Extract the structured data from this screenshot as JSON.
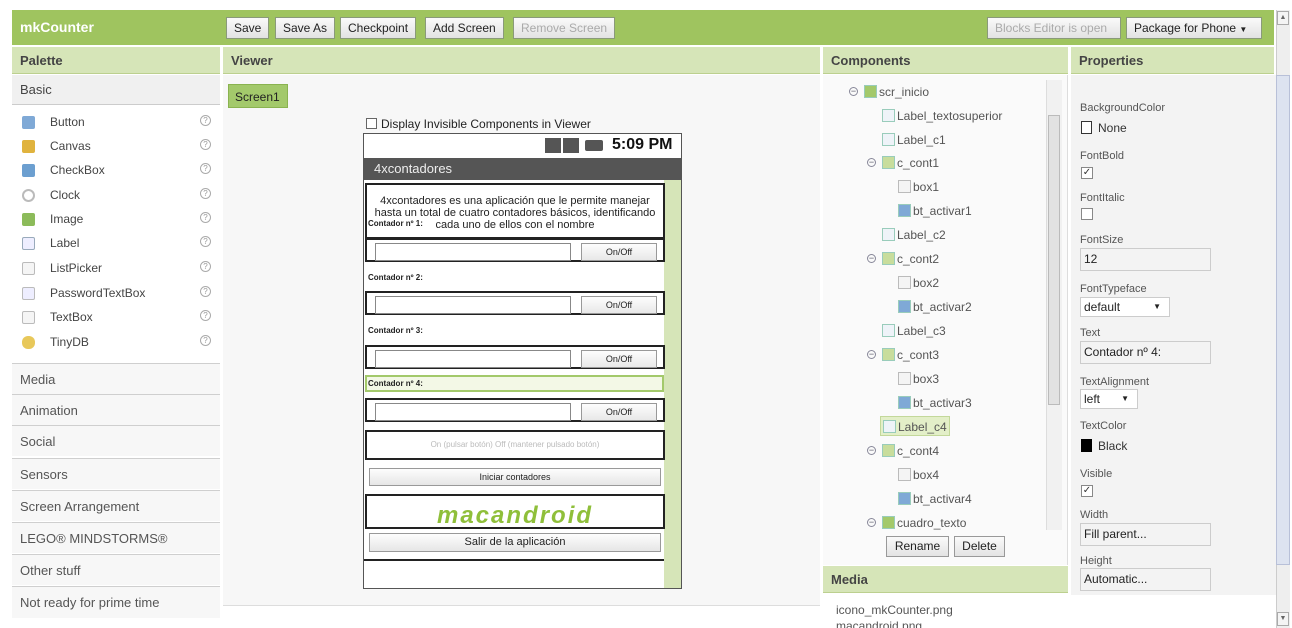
{
  "app": {
    "title": "mkCounter"
  },
  "toolbar": {
    "save": "Save",
    "save_as": "Save As",
    "checkpoint": "Checkpoint",
    "add_screen": "Add Screen",
    "remove_screen": "Remove Screen",
    "blocks_editor": "Blocks Editor is open",
    "package": "Package for Phone"
  },
  "palette": {
    "title": "Palette",
    "category_basic": "Basic",
    "items": [
      {
        "label": "Button",
        "icon": "button-icon"
      },
      {
        "label": "Canvas",
        "icon": "canvas-icon"
      },
      {
        "label": "CheckBox",
        "icon": "checkbox-icon"
      },
      {
        "label": "Clock",
        "icon": "clock-icon"
      },
      {
        "label": "Image",
        "icon": "image-icon"
      },
      {
        "label": "Label",
        "icon": "label-icon"
      },
      {
        "label": "ListPicker",
        "icon": "listpicker-icon"
      },
      {
        "label": "PasswordTextBox",
        "icon": "password-icon"
      },
      {
        "label": "TextBox",
        "icon": "textbox-icon"
      },
      {
        "label": "TinyDB",
        "icon": "database-icon"
      }
    ],
    "help_symbol": "?",
    "categories": [
      "Media",
      "Animation",
      "Social",
      "Sensors",
      "Screen Arrangement",
      "LEGO® MINDSTORMS®",
      "Other stuff",
      "Not ready for prime time"
    ]
  },
  "viewer": {
    "title": "Viewer",
    "screen_button": "Screen1",
    "display_invisible": "Display Invisible Components in Viewer",
    "phone": {
      "time": "5:09 PM",
      "app_title": "4xcontadores",
      "description": "4xcontadores es una aplicación que le permite manejar hasta un total de cuatro contadores básicos, identificando cada uno de ellos con el nombre",
      "counters": [
        "Contador nº 1:",
        "Contador nº 2:",
        "Contador nº 3:",
        "Contador nº 4:"
      ],
      "onoff": "On/Off",
      "hint": "On (pulsar botón) Off (mantener pulsado botón)",
      "start": "Iniciar contadores",
      "logo": "macandroid",
      "exit": "Salir de la aplicación"
    }
  },
  "components": {
    "title": "Components",
    "tree": [
      "scr_inicio",
      "Label_textosuperior",
      "Label_c1",
      "c_cont1",
      "box1",
      "bt_activar1",
      "Label_c2",
      "c_cont2",
      "box2",
      "bt_activar2",
      "Label_c3",
      "c_cont3",
      "box3",
      "bt_activar3",
      "Label_c4",
      "c_cont4",
      "box4",
      "bt_activar4",
      "cuadro_texto"
    ],
    "rename": "Rename",
    "delete": "Delete"
  },
  "media": {
    "title": "Media",
    "files": [
      "icono_mkCounter.png",
      "macandroid.png"
    ]
  },
  "properties": {
    "title": "Properties",
    "background_color_label": "BackgroundColor",
    "background_color_value": "None",
    "fontbold_label": "FontBold",
    "fontitalic_label": "FontItalic",
    "fontsize_label": "FontSize",
    "fontsize_value": "12",
    "fonttypeface_label": "FontTypeface",
    "fonttypeface_value": "default",
    "text_label": "Text",
    "text_value": "Contador nº 4:",
    "textalign_label": "TextAlignment",
    "textalign_value": "left",
    "textcolor_label": "TextColor",
    "textcolor_value": "Black",
    "visible_label": "Visible",
    "width_label": "Width",
    "width_value": "Fill parent...",
    "height_label": "Height",
    "height_value": "Automatic...",
    "check": "✓"
  },
  "colors": {
    "brand": "#94bf4b",
    "header": "#d6e5b8",
    "selected": "#e3efc8"
  }
}
